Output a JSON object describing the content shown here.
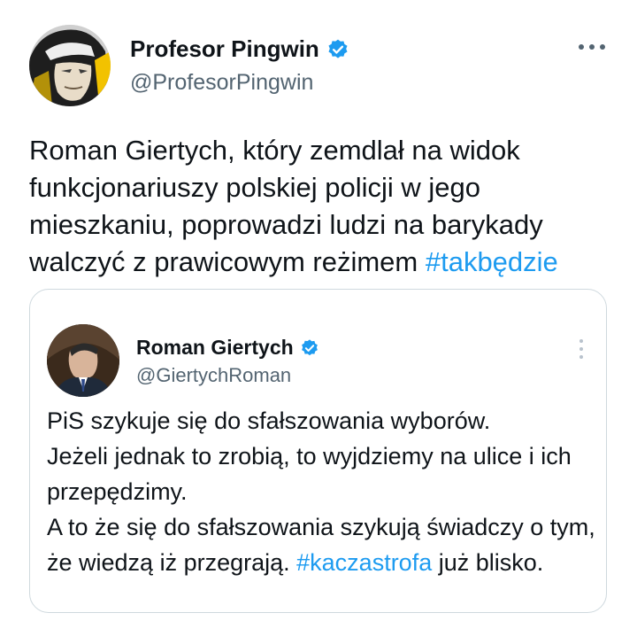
{
  "tweet": {
    "author_name": "Profesor Pingwin",
    "author_handle": "@ProfesorPingwin",
    "text": "Roman Giertych, który zemdlał na widok funkcjonariuszy polskiej policji w jego mieszkaniu, poprowadzi ludzi na barykady walczyć z prawicowym reżimem ",
    "hashtag": "#takbędzie",
    "icons": {
      "verified": "verified-badge-icon",
      "more": "more-options-icon"
    }
  },
  "quoted_tweet": {
    "author_name": "Roman Giertych",
    "author_handle": "@GiertychRoman",
    "text_part1": "PiS szykuje się do sfałszowania wyborów.\nJeżeli jednak to zrobią, to wyjdziemy na ulice i ich przepędzimy.\nA to że się do sfałszowania szykują świadczy o tym, że wiedzą iż przegrają. ",
    "hashtag": "#kaczastrofa",
    "text_part2": " już blisko."
  },
  "colors": {
    "link": "#1d9bf0",
    "verified": "#1d9bf0",
    "secondary_text": "#536471",
    "border": "#cfd9de"
  }
}
